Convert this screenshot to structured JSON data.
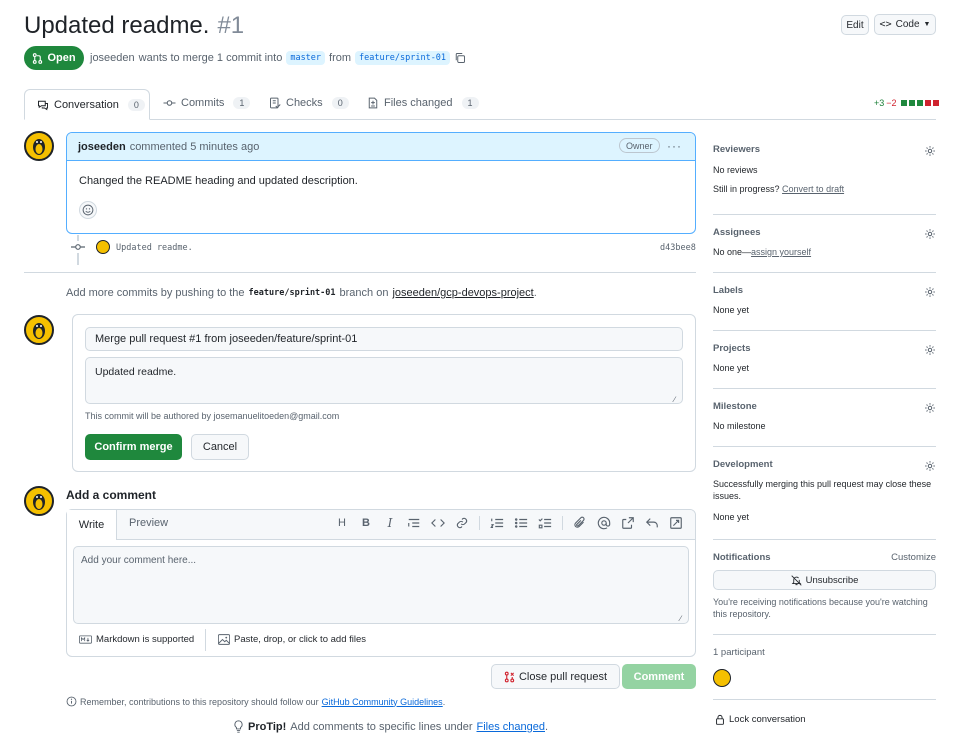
{
  "header": {
    "title": "Updated readme.",
    "number": "#1",
    "edit_label": "Edit",
    "code_label": "Code",
    "state_label": "Open",
    "author": "joseeden",
    "merge_text": "wants to merge 1 commit into",
    "base_branch": "master",
    "from_text": "from",
    "head_branch": "feature/sprint-01"
  },
  "tabs": [
    {
      "label": "Conversation",
      "count": "0"
    },
    {
      "label": "Commits",
      "count": "1"
    },
    {
      "label": "Checks",
      "count": "0"
    },
    {
      "label": "Files changed",
      "count": "1"
    }
  ],
  "diffstat": {
    "additions": "+3",
    "deletions": "−2"
  },
  "comment": {
    "author": "joseeden",
    "action": "commented 5 minutes ago",
    "role_badge": "Owner",
    "body": "Changed the README heading and updated description."
  },
  "commit": {
    "message": "Updated readme.",
    "sha": "d43bee8"
  },
  "push_hint": {
    "prefix": "Add more commits by pushing to the",
    "branch": "feature/sprint-01",
    "middle": "branch on",
    "repo": "joseeden/gcp-devops-project",
    "suffix": "."
  },
  "merge_box": {
    "title_value": "Merge pull request #1 from joseeden/feature/sprint-01",
    "body_value": "Updated readme.",
    "author_note": "This commit will be authored by josemanuelitoeden@gmail.com",
    "confirm_label": "Confirm merge",
    "cancel_label": "Cancel"
  },
  "add_comment": {
    "heading": "Add a comment",
    "tab_write": "Write",
    "tab_preview": "Preview",
    "placeholder": "Add your comment here...",
    "markdown_note": "Markdown is supported",
    "attach_note": "Paste, drop, or click to add files",
    "close_label": "Close pull request",
    "comment_label": "Comment"
  },
  "footer": {
    "guidelines_prefix": "Remember, contributions to this repository should follow our",
    "guidelines_link": "GitHub Community Guidelines",
    "guidelines_suffix": ".",
    "protip_label": "ProTip!",
    "protip_text": "Add comments to specific lines under",
    "protip_link": "Files changed",
    "protip_suffix": "."
  },
  "sidebar": {
    "reviewers": {
      "title": "Reviewers",
      "value": "No reviews",
      "progress_text": "Still in progress?",
      "progress_link": "Convert to draft"
    },
    "assignees": {
      "title": "Assignees",
      "value_prefix": "No one—",
      "value_link": "assign yourself"
    },
    "labels": {
      "title": "Labels",
      "value": "None yet"
    },
    "projects": {
      "title": "Projects",
      "value": "None yet"
    },
    "milestone": {
      "title": "Milestone",
      "value": "No milestone"
    },
    "development": {
      "title": "Development",
      "text": "Successfully merging this pull request may close these issues.",
      "value": "None yet"
    },
    "notifications": {
      "title": "Notifications",
      "customize": "Customize",
      "unsubscribe_label": "Unsubscribe",
      "note": "You're receiving notifications because you're watching this repository."
    },
    "participants": {
      "title": "1 participant"
    },
    "lock_label": "Lock conversation"
  },
  "colors": {
    "green": "#1f883d",
    "green_light": "#94d3a2",
    "blue_header": "#ddf4ff",
    "blue_border": "#54aeff"
  }
}
